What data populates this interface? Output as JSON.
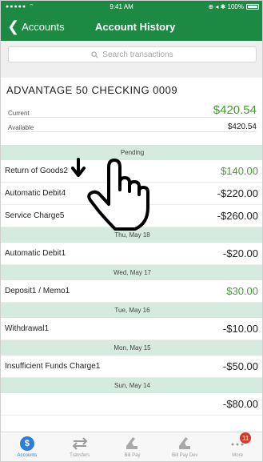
{
  "status_bar": {
    "signal": "●●●●● ⌔",
    "time": "9:41 AM",
    "battery": "⊕ ◂ ✱ 100%"
  },
  "nav": {
    "back_label": "Accounts",
    "title": "Account History"
  },
  "search": {
    "placeholder": "Search transactions"
  },
  "account": {
    "name": "ADVANTAGE 50 CHECKING 0009",
    "current_label": "Current",
    "current_value": "$420.54",
    "available_label": "Available",
    "available_value": "$420.54"
  },
  "groups": [
    {
      "header": "Pending",
      "items": [
        {
          "desc": "Return of Goods2",
          "amount": "$140.00"
        },
        {
          "desc": "Automatic Debit4",
          "amount": "-$220.00"
        },
        {
          "desc": "Service Charge5",
          "amount": "-$260.00"
        }
      ]
    },
    {
      "header": "Thu, May 18",
      "items": [
        {
          "desc": "Automatic Debit1",
          "amount": "-$20.00"
        }
      ]
    },
    {
      "header": "Wed, May 17",
      "items": [
        {
          "desc": "Deposit1 / Memo1",
          "amount": "$30.00"
        }
      ]
    },
    {
      "header": "Tue, May 16",
      "items": [
        {
          "desc": "Withdrawal1",
          "amount": "-$10.00"
        }
      ]
    },
    {
      "header": "Mon, May 15",
      "items": [
        {
          "desc": "Insufficient Funds Charge1",
          "amount": "-$50.00"
        }
      ]
    },
    {
      "header": "Sun, May 14",
      "items": [
        {
          "desc": "",
          "amount": "-$80.00"
        }
      ]
    }
  ],
  "tabs": [
    {
      "label": "Accounts",
      "icon": "dollar-icon"
    },
    {
      "label": "Transfers",
      "icon": "transfer-icon"
    },
    {
      "label": "Bill Pay",
      "icon": "bill-pay-icon"
    },
    {
      "label": "Bill Pay Dev",
      "icon": "bill-pay-dev-icon"
    },
    {
      "label": "More",
      "icon": "more-icon",
      "badge": "11"
    }
  ],
  "colors": {
    "nav_green": "#1c8a43",
    "positive_green": "#46a032",
    "section_header": "#d5ebe0",
    "active_tab_blue": "#2e7dd8",
    "badge_red": "#d23a2a"
  }
}
